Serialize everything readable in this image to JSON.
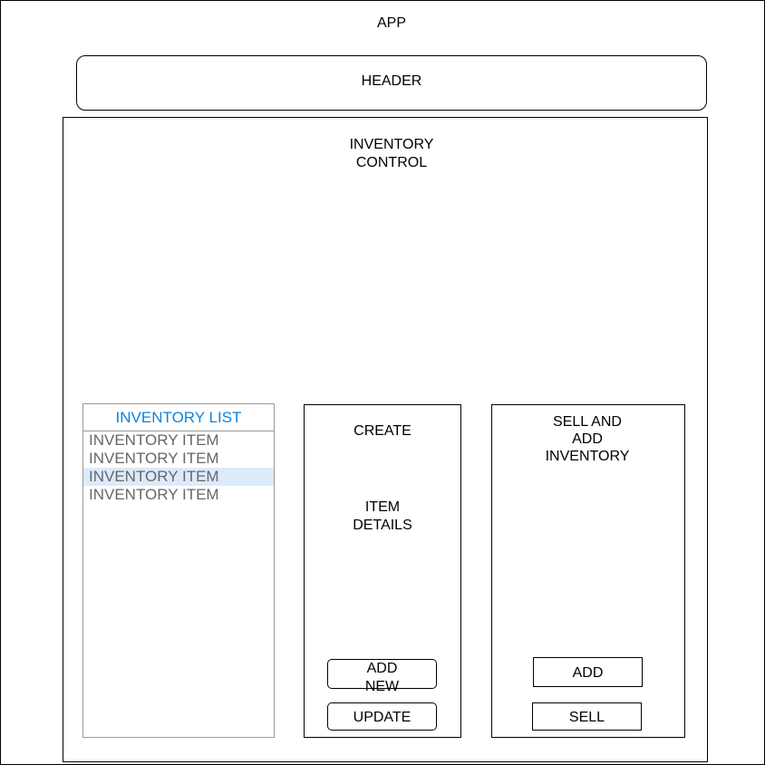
{
  "app": {
    "title": "APP"
  },
  "header": {
    "label": "HEADER"
  },
  "inventory_control": {
    "title": "INVENTORY\nCONTROL",
    "inventory_list": {
      "title": "INVENTORY LIST",
      "accent_color": "#0a84e0",
      "selected_highlight": "#dcebfa",
      "items": [
        {
          "label": "INVENTORY ITEM",
          "selected": false
        },
        {
          "label": "INVENTORY ITEM",
          "selected": false
        },
        {
          "label": "INVENTORY ITEM",
          "selected": true
        },
        {
          "label": "INVENTORY ITEM",
          "selected": false
        }
      ]
    },
    "create_panel": {
      "title": "CREATE",
      "details": "ITEM\nDETAILS",
      "add_new_label": "ADD\nNEW",
      "update_label": "UPDATE"
    },
    "sell_panel": {
      "title": "SELL AND\nADD\nINVENTORY",
      "add_label": "ADD",
      "sell_label": "SELL"
    }
  }
}
